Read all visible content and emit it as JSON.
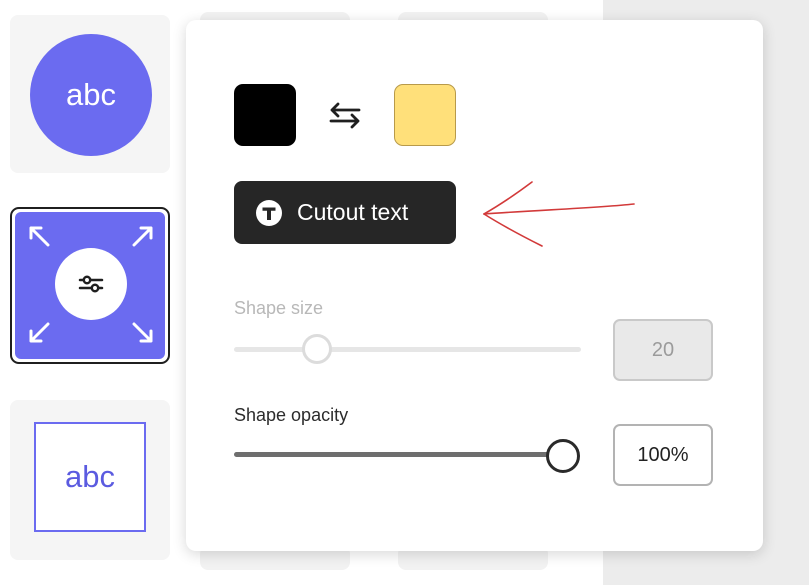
{
  "styles": [
    {
      "label": "abc",
      "variant": "filled-circle"
    },
    {
      "label": "",
      "variant": "edit-selected"
    },
    {
      "label": "abc",
      "variant": "outlined-square"
    }
  ],
  "colors": {
    "accent": "#6b6bf0",
    "foreground_swatch": "#000000",
    "background_swatch": "#ffe07a",
    "button_dark": "#262626"
  },
  "popover": {
    "cutout_button_label": "Cutout text",
    "cutout_button_icon": "text-t-icon",
    "swap_icon": "swap-arrows-icon",
    "shape_size": {
      "label": "Shape size",
      "value": "20",
      "slider_fraction": 0.24,
      "enabled": false
    },
    "shape_opacity": {
      "label": "Shape opacity",
      "value": "100%",
      "slider_fraction": 1.0,
      "enabled": true
    }
  }
}
